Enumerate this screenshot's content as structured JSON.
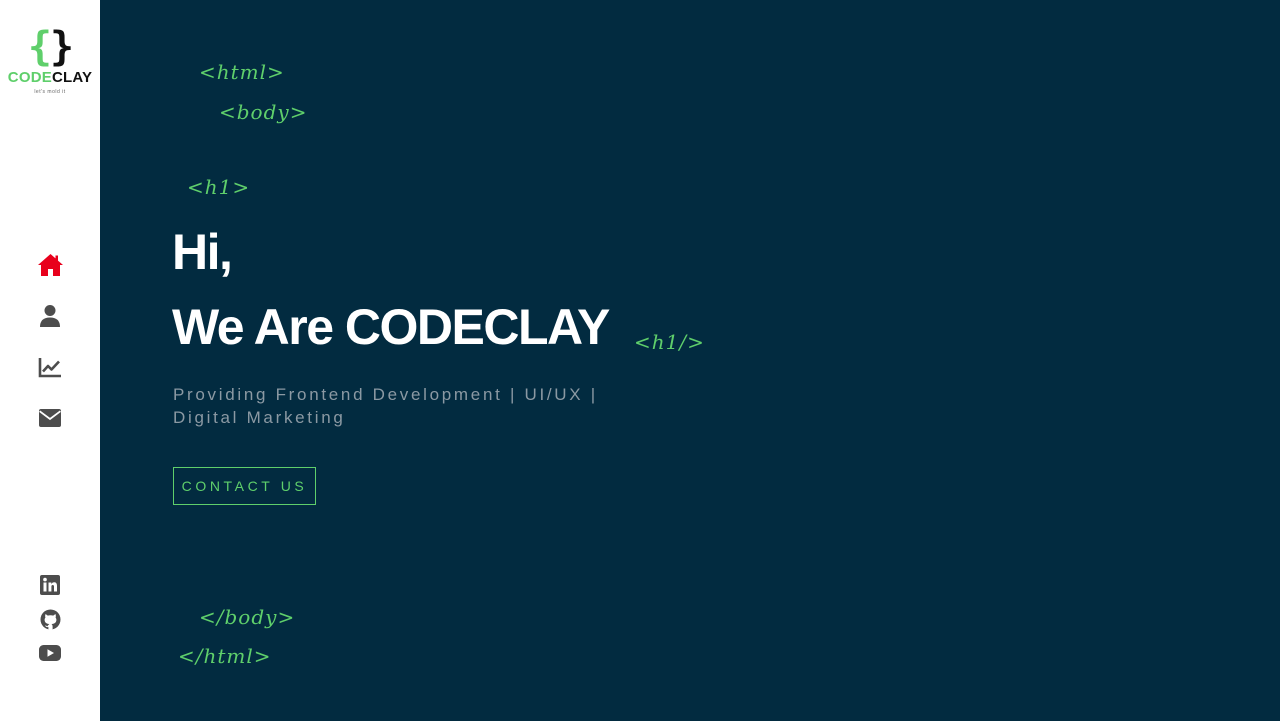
{
  "brand": {
    "open_brace": "{",
    "close_brace": "}",
    "name_part1": "CODE",
    "name_part2": "CLAY",
    "tagline": "let's mold it"
  },
  "sidebar": {
    "nav": [
      {
        "icon": "home-icon",
        "active": true
      },
      {
        "icon": "user-icon",
        "active": false
      },
      {
        "icon": "chart-line-icon",
        "active": false
      },
      {
        "icon": "envelope-icon",
        "active": false
      }
    ],
    "social": [
      {
        "icon": "linkedin-icon"
      },
      {
        "icon": "github-icon"
      },
      {
        "icon": "youtube-icon"
      }
    ]
  },
  "decor_tags": {
    "html_open": "<html>",
    "body_open": "<body>",
    "h1_open": "<h1>",
    "h1_close": "<h1/>",
    "body_close": "</body>",
    "html_close": "</html>"
  },
  "hero": {
    "line1": "Hi,",
    "line2": "We Are CODECLAY",
    "subtitle": "Providing Frontend Development | UI/UX | Digital Marketing",
    "cta_label": "CONTACT US"
  },
  "colors": {
    "background": "#022b40",
    "sidebar": "#ffffff",
    "accent_green": "#5fcf6b",
    "active_icon": "#e8001c",
    "icon_gray": "#4d4d4d",
    "subtitle_gray": "#8b99a3"
  }
}
